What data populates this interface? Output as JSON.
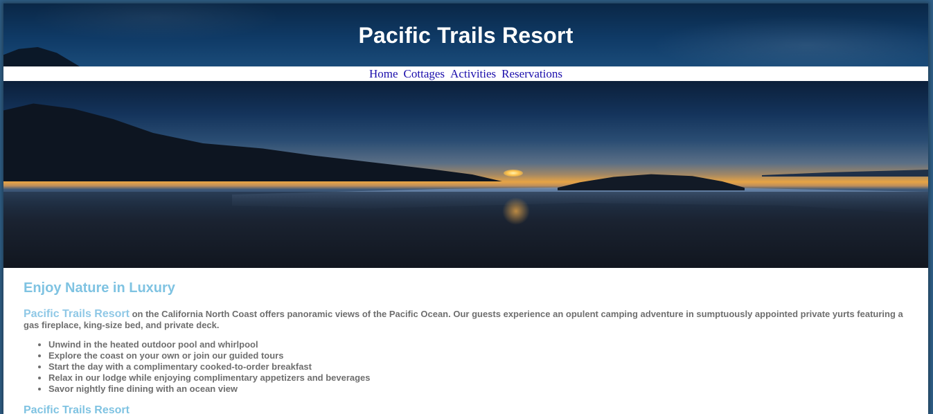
{
  "header": {
    "title": "Pacific Trails Resort"
  },
  "nav": {
    "items": [
      "Home",
      "Cottages",
      "Activities",
      "Reservations"
    ]
  },
  "content": {
    "heading": "Enjoy Nature in Luxury",
    "intro_highlight": "Pacific Trails Resort",
    "intro_text": " on the California North Coast offers panoramic views of the Pacific Ocean. Our guests experience an opulent camping adventure in sumptuously appointed private yurts featuring a gas fireplace, king-size bed, and private deck.",
    "features": [
      "Unwind in the heated outdoor pool and whirlpool",
      "Explore the coast on your own or join our guided tours",
      "Start the day with a complimentary cooked-to-order breakfast",
      "Relax in our lodge while enjoying complimentary appetizers and beverages",
      "Savor nightly fine dining with an ocean view"
    ],
    "contact_heading": "Pacific Trails Resort"
  },
  "colors": {
    "heading": "#7fc3e2",
    "body_text": "#6e6e6e",
    "nav_link": "#1a0dab",
    "header_bg": "#0f3a66"
  },
  "hero_image": "sunset-beach-image"
}
